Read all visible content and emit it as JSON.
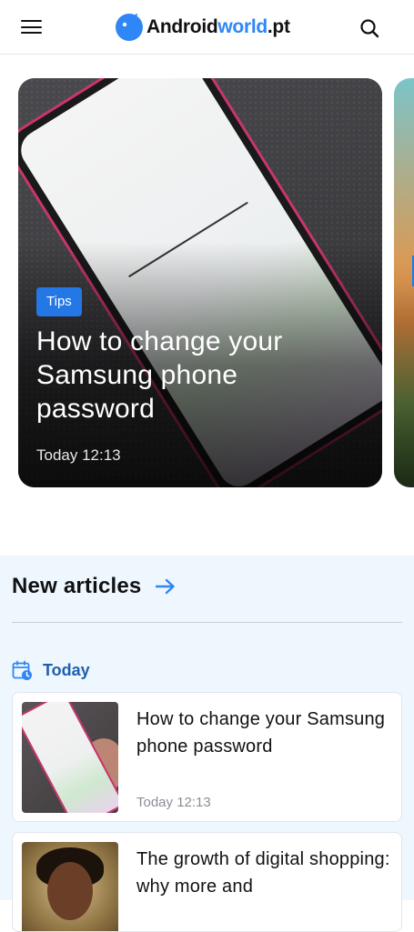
{
  "header": {
    "logo": {
      "part1": "Android",
      "part2": "world",
      "part3": ".pt"
    },
    "menu_icon": "hamburger-menu-icon",
    "search_icon": "search-icon"
  },
  "featured": {
    "tag": "Tips",
    "title": "How to change your Samsung phone password",
    "time": "Today 12:13"
  },
  "articles": {
    "section_title": "New articles",
    "day_label": "Today",
    "items": [
      {
        "title": "How to change your Samsung phone password",
        "time": "Today 12:13"
      },
      {
        "title": "The growth of digital shopping: why more and"
      }
    ]
  },
  "colors": {
    "brand_blue": "#2f86f6",
    "tag_blue": "#2378e6",
    "section_bg": "#eef6fe",
    "day_label": "#1f5fae"
  }
}
